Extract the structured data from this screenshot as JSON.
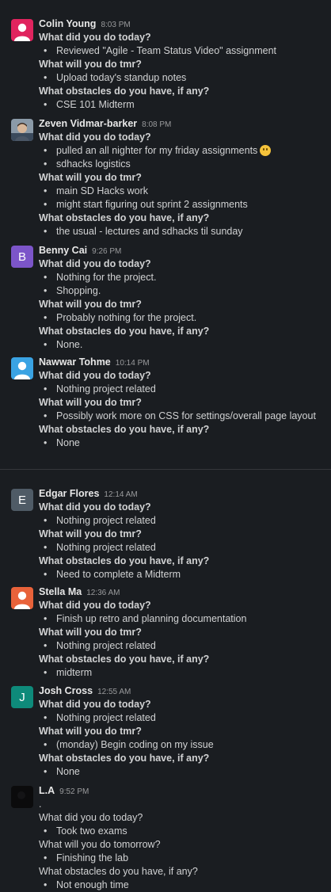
{
  "messages": [
    {
      "name": "Colin Young",
      "time": "8:03 PM",
      "avatar": "default-user-icon",
      "avatar_color": "#e0245e",
      "lines": [
        {
          "kind": "q",
          "text": "What did you do today?"
        },
        {
          "kind": "b",
          "text": "Reviewed \"Agile - Team Status Video\" assignment"
        },
        {
          "kind": "q",
          "text": "What will you do tmr?"
        },
        {
          "kind": "b",
          "text": "Upload today's standup notes"
        },
        {
          "kind": "q",
          "text": "What obstacles do you have, if any?"
        },
        {
          "kind": "b",
          "text": "CSE 101 Midterm"
        }
      ]
    },
    {
      "name": "Zeven Vidmar-barker",
      "time": "8:08 PM",
      "avatar": "profile-photo",
      "avatar_color": "#6b7a8a",
      "lines": [
        {
          "kind": "q",
          "text": "What did you do today?"
        },
        {
          "kind": "b",
          "text": "pulled an all nighter for my friday assignments",
          "emoji": "slightly-smiling-face"
        },
        {
          "kind": "b",
          "text": "sdhacks logistics"
        },
        {
          "kind": "q",
          "text": "What will you do tmr?"
        },
        {
          "kind": "b",
          "text": "main SD Hacks work"
        },
        {
          "kind": "b",
          "text": "might start figuring out sprint 2 assignments"
        },
        {
          "kind": "q",
          "text": "What obstacles do you have, if any?"
        },
        {
          "kind": "b",
          "text": "the usual - lectures and sdhacks til sunday"
        }
      ]
    },
    {
      "name": "Benny Cai",
      "time": "9:26 PM",
      "avatar": "B",
      "avatar_color": "#7c55c9",
      "lines": [
        {
          "kind": "q",
          "text": "What did you do today?"
        },
        {
          "kind": "b",
          "text": "Nothing for the project."
        },
        {
          "kind": "b",
          "text": "Shopping."
        },
        {
          "kind": "q",
          "text": "What will you do tmr?"
        },
        {
          "kind": "b",
          "text": "Probably nothing for the project."
        },
        {
          "kind": "q",
          "text": "What obstacles do you have, if any?"
        },
        {
          "kind": "b",
          "text": "None."
        }
      ]
    },
    {
      "name": "Nawwar Tohme",
      "time": "10:14 PM",
      "avatar": "default-user-icon",
      "avatar_color": "#3aa3e3",
      "lines": [
        {
          "kind": "q",
          "text": "What did you do today?"
        },
        {
          "kind": "b",
          "text": "Nothing project related"
        },
        {
          "kind": "q",
          "text": "What will you do tmr?"
        },
        {
          "kind": "b",
          "text": "Possibly work more on CSS for settings/overall page layout"
        },
        {
          "kind": "q",
          "text": "What obstacles do you have, if any?"
        },
        {
          "kind": "b",
          "text": "None"
        }
      ]
    },
    {
      "name": "Edgar Flores",
      "time": "12:14 AM",
      "avatar": "E",
      "avatar_color": "#4f5b66",
      "lines": [
        {
          "kind": "q",
          "text": "What did you do today?"
        },
        {
          "kind": "b",
          "text": "Nothing project related"
        },
        {
          "kind": "q",
          "text": "What will you do tmr?"
        },
        {
          "kind": "b",
          "text": "Nothing project related"
        },
        {
          "kind": "q",
          "text": "What obstacles do you have, if any?"
        },
        {
          "kind": "b",
          "text": "Need to complete a Midterm"
        }
      ]
    },
    {
      "name": "Stella Ma",
      "time": "12:36 AM",
      "avatar": "default-user-icon",
      "avatar_color": "#e8623a",
      "lines": [
        {
          "kind": "q",
          "text": "What did you do today?"
        },
        {
          "kind": "b",
          "text": "Finish up retro and planning documentation"
        },
        {
          "kind": "q",
          "text": "What will you do tmr?"
        },
        {
          "kind": "b",
          "text": "Nothing project related"
        },
        {
          "kind": "q",
          "text": "What obstacles do you have, if any?"
        },
        {
          "kind": "b",
          "text": "midterm"
        }
      ]
    },
    {
      "name": "Josh Cross",
      "time": "12:55 AM",
      "avatar": "J",
      "avatar_color": "#0e8a7a",
      "lines": [
        {
          "kind": "q",
          "text": "What did you do today?"
        },
        {
          "kind": "b",
          "text": "Nothing project related"
        },
        {
          "kind": "q",
          "text": "What will you do tmr?"
        },
        {
          "kind": "b",
          "text": "(monday) Begin coding on my issue"
        },
        {
          "kind": "q",
          "text": "What obstacles do you have, if any?"
        },
        {
          "kind": "b",
          "text": "None"
        }
      ]
    },
    {
      "name": "L.A",
      "time": "9:52 PM",
      "avatar": "dark-profile-photo",
      "avatar_color": "#0b0b0c",
      "lines": [
        {
          "kind": "t",
          "text": "."
        },
        {
          "kind": "p",
          "text": "What did you do today?"
        },
        {
          "kind": "b",
          "text": "Took two exams"
        },
        {
          "kind": "p",
          "text": "What will you do tomorrow?"
        },
        {
          "kind": "b",
          "text": "Finishing the lab"
        },
        {
          "kind": "p",
          "text": "What obstacles do you have, if any?"
        },
        {
          "kind": "b",
          "text": "Not enough time"
        }
      ]
    }
  ]
}
